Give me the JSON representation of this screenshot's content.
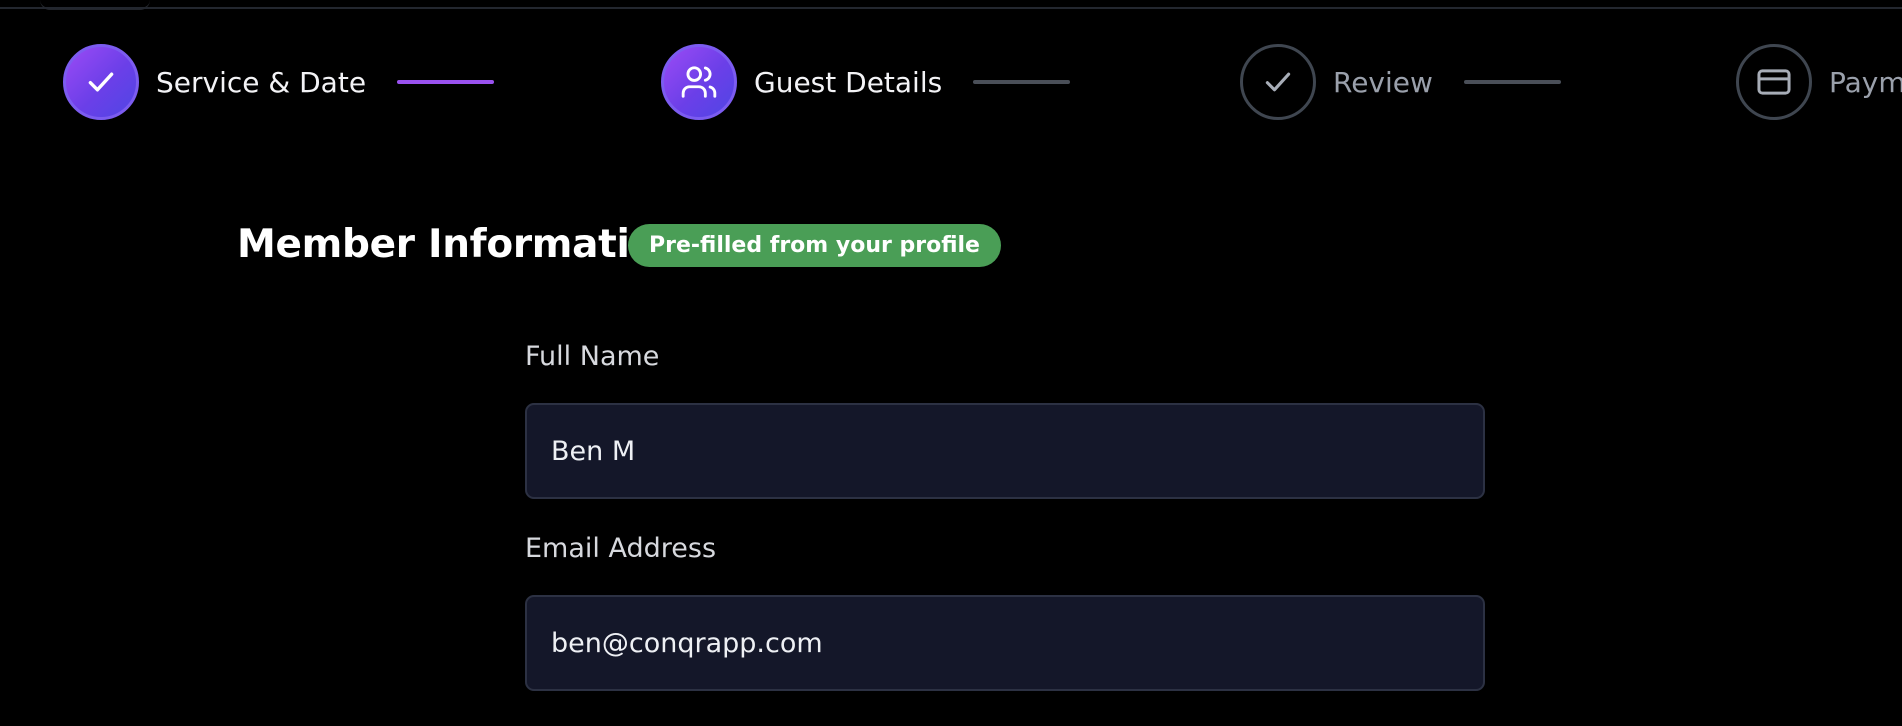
{
  "stepper": {
    "steps": [
      {
        "label": "Service & Date",
        "icon": "check-icon",
        "state": "completed"
      },
      {
        "label": "Guest Details",
        "icon": "users-icon",
        "state": "current"
      },
      {
        "label": "Review",
        "icon": "check-icon",
        "state": "pending"
      },
      {
        "label": "Paym",
        "icon": "credit-card-icon",
        "state": "pending"
      }
    ]
  },
  "section": {
    "title": "Member Information",
    "badge": "Pre-filled from your profile"
  },
  "form": {
    "full_name": {
      "label": "Full Name",
      "value": "Ben M"
    },
    "email": {
      "label": "Email Address",
      "value": "ben@conqrapp.com"
    }
  },
  "colors": {
    "accent_purple": "#9a52f0",
    "badge_green": "#4a9e56",
    "input_bg": "#141729"
  }
}
